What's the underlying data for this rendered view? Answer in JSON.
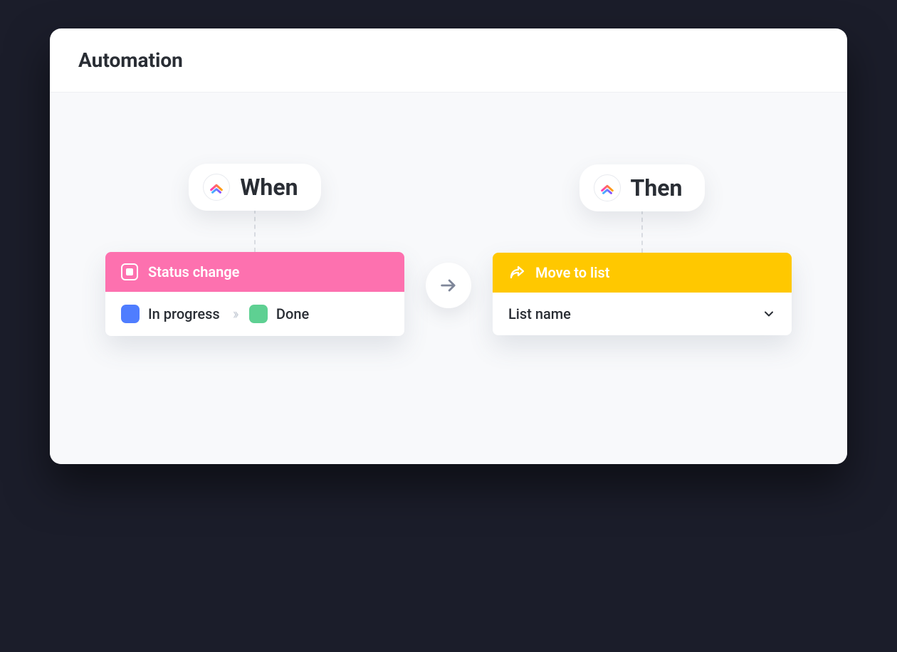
{
  "header": {
    "title": "Automation"
  },
  "when": {
    "label": "When",
    "trigger_title": "Status change",
    "from_status": {
      "label": "In progress",
      "color": "#4f7dff"
    },
    "to_status": {
      "label": "Done",
      "color": "#5ed092"
    }
  },
  "then": {
    "label": "Then",
    "action_title": "Move to list",
    "list_select_label": "List name"
  },
  "colors": {
    "trigger_bg": "#fd71af",
    "action_bg": "#ffc800"
  }
}
